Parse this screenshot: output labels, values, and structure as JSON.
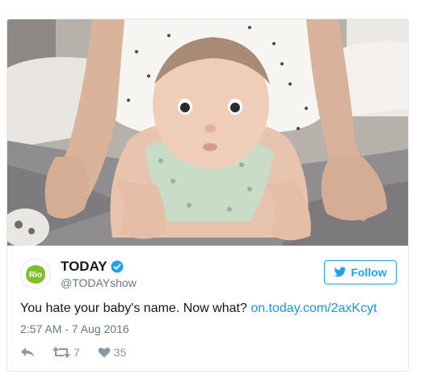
{
  "tweet": {
    "display_name": "TODAY",
    "handle": "@TODAYshow",
    "follow_label": "Follow",
    "text": "You hate your baby's name. Now what?",
    "link": "on.today.com/2axKcyt",
    "timestamp": "2:57 AM - 7 Aug 2016",
    "retweet_count": "7",
    "like_count": "35",
    "avatar_text": "Rio"
  },
  "icons": {
    "verified": "verified-badge-icon",
    "follow_bird": "twitter-bird-icon",
    "reply": "reply-icon",
    "retweet": "retweet-icon",
    "like": "heart-icon"
  },
  "colors": {
    "twitter_blue": "#1da1f2",
    "link_blue": "#1b95e0",
    "muted_text": "#657786",
    "action_gray": "#8899a6",
    "avatar_green": "#7fbf2a"
  }
}
